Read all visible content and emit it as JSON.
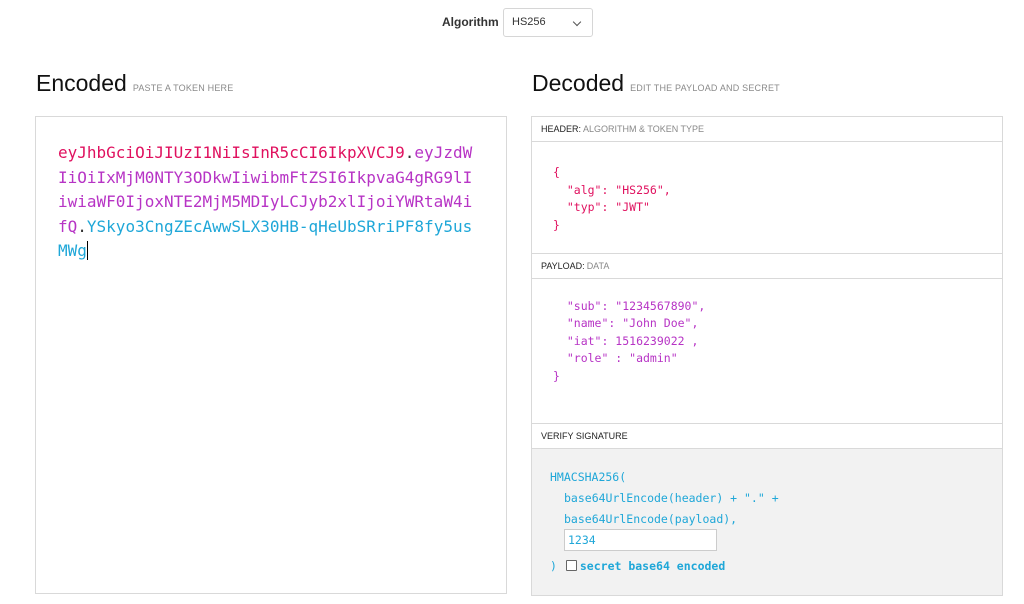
{
  "algorithm": {
    "label": "Algorithm",
    "selected": "HS256"
  },
  "encoded": {
    "title": "Encoded",
    "subtitle": "PASTE A TOKEN HERE",
    "token": {
      "header": "eyJhbGciOiJIUzI1NiIsInR5cCI6IkpXVCJ9",
      "payload": "eyJzdWIiOiIxMjM0NTY3ODkwIiwibmFtZSI6IkpvaG4gRG9lIiwiaWF0IjoxNTE2MjM5MDIyLCJyb2xlIjoiYWRtaW4ifQ",
      "signature": "YSkyo3CngZEcAwwSLX30HB-qHeUbSRriPF8fy5usMWg",
      "separator": "."
    }
  },
  "decoded": {
    "title": "Decoded",
    "subtitle": "EDIT THE PAYLOAD AND SECRET",
    "header_section": {
      "label": "HEADER:",
      "desc": "ALGORITHM & TOKEN TYPE"
    },
    "header_json": "{\n  \"alg\": \"HS256\",\n  \"typ\": \"JWT\"\n}",
    "payload_section": {
      "label": "PAYLOAD:",
      "desc": "DATA"
    },
    "payload_json": "\n  \"sub\": \"1234567890\",\n  \"name\": \"John Doe\",\n  \"iat\": 1516239022 ,\n  \"role\" : \"admin\"\n}",
    "verify_section": {
      "label": "VERIFY SIGNATURE"
    },
    "verify": {
      "line1": "HMACSHA256(",
      "line2": "base64UrlEncode(header) + \".\" +",
      "line3": "base64UrlEncode(payload),",
      "secret": "1234",
      "close": ")",
      "checkbox_label": "secret base64 encoded"
    }
  },
  "colors": {
    "header": "#e0115f",
    "payload": "#b734c5",
    "signature": "#1fa7d8"
  }
}
